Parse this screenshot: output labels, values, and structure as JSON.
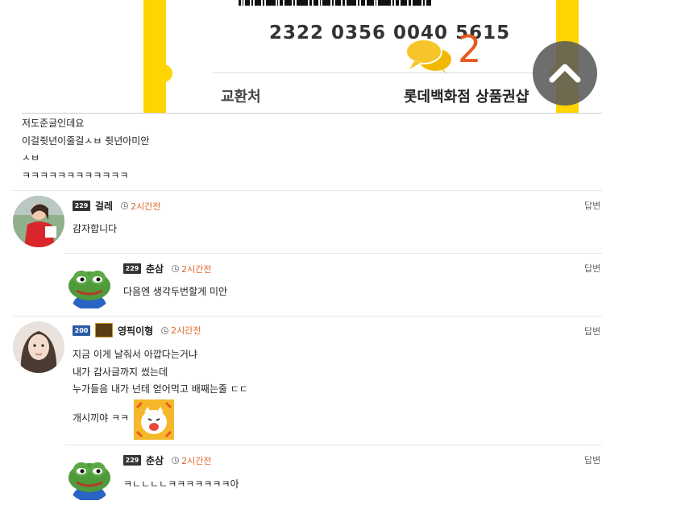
{
  "voucher": {
    "number": "2322 0356 0040 5615",
    "exchange_label": "교환처",
    "store_name": "롯데백화점 상품권샵"
  },
  "comment_count": "2",
  "post": {
    "lines": [
      "저도준글인데요",
      "이걸쥣년이줄걸ㅅㅂ 쥣년아미안",
      "ㅅㅂ",
      "ㅋㅋㅋㅋㅋㅋㅋㅋㅋㅋㅋㅋ"
    ]
  },
  "comments": [
    {
      "level": "229",
      "nickname": "걸레",
      "time": "2시간전",
      "reply": "답변",
      "lines": [
        "감자합니다"
      ]
    },
    {
      "level": "229",
      "nickname": "춘삼",
      "time": "2시간전",
      "reply": "답변",
      "lines": [
        "다음엔 생각두번할게 미안"
      ]
    },
    {
      "level": "200",
      "nickname": "영픽이형",
      "time": "2시간전",
      "reply": "답변",
      "lines": [
        "지금 이게 날줘서 아깝다는거냐",
        "내가 감사글까지 썼는데",
        "누가들음 내가 넌테 얻어먹고 배째는줄 ㄷㄷ",
        "개시끼야 ㅋㅋ"
      ]
    },
    {
      "level": "229",
      "nickname": "춘삼",
      "time": "2시간전",
      "reply": "답변",
      "lines": [
        "ㅋㄴㄴㄴㄴㅋㅋㅋㅋㅋㅋㅋ아"
      ]
    }
  ],
  "colors": {
    "voucher_yellow": "#ffd400",
    "time_orange": "#e0662a",
    "count_orange": "#e55a1e"
  },
  "icons": [
    "comment-bubble-icon",
    "scroll-up-chevron-icon",
    "clock-icon",
    "frog-avatar-icon",
    "emoticon-icon"
  ]
}
